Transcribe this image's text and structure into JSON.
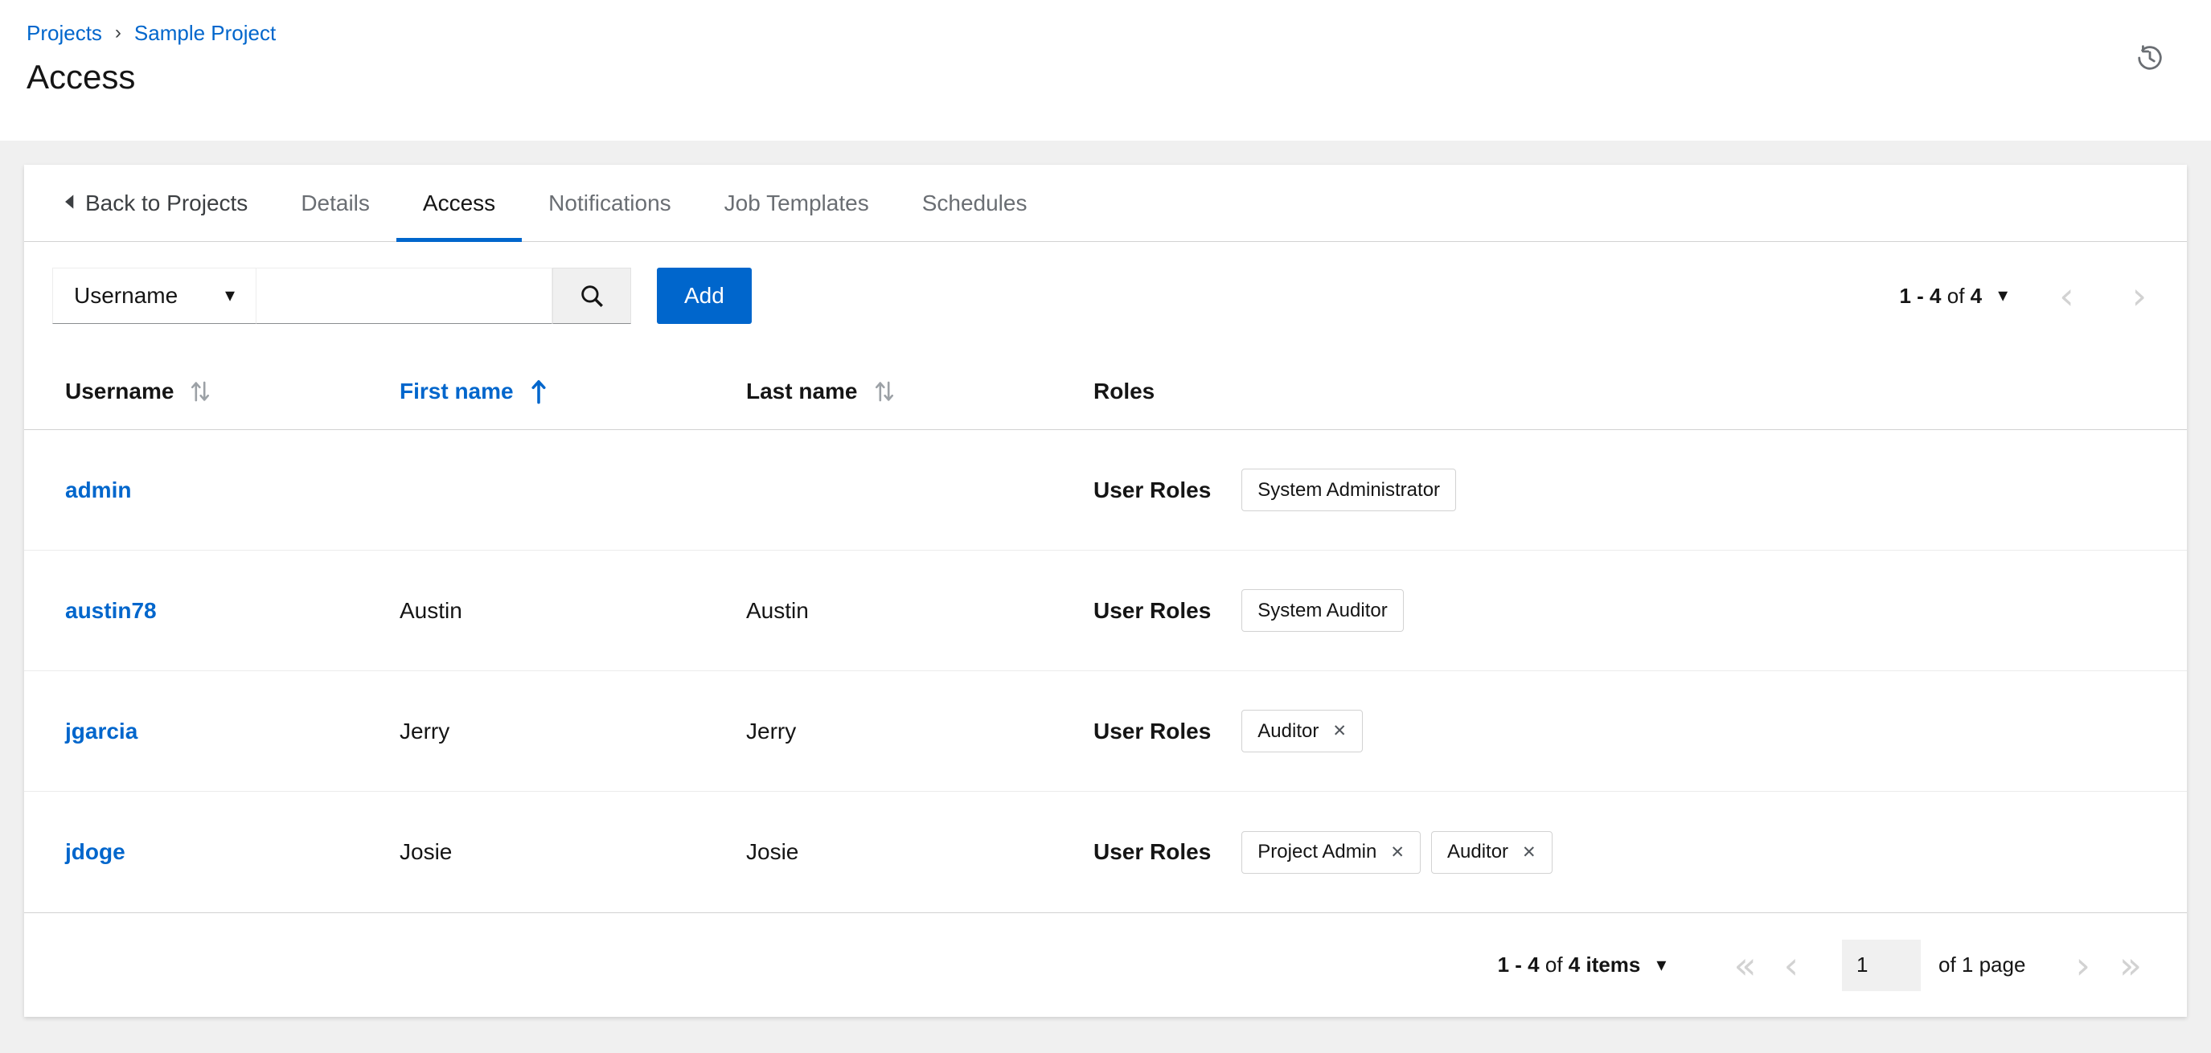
{
  "breadcrumb": {
    "separator": "›",
    "items": [
      {
        "label": "Projects"
      },
      {
        "label": "Sample Project"
      }
    ]
  },
  "page": {
    "title": "Access"
  },
  "tabs": {
    "back_label": "Back to Projects",
    "active": "Access",
    "items": [
      {
        "label": "Details"
      },
      {
        "label": "Access"
      },
      {
        "label": "Notifications"
      },
      {
        "label": "Job Templates"
      },
      {
        "label": "Schedules"
      }
    ]
  },
  "toolbar": {
    "filter_dropdown": {
      "selected": "Username"
    },
    "search": {
      "value": ""
    },
    "add_button": {
      "label": "Add"
    },
    "pagination": {
      "range": "1 - 4",
      "of": "of",
      "total": "4"
    }
  },
  "table": {
    "columns": [
      {
        "label": "Username",
        "sortable": true,
        "sorted": ""
      },
      {
        "label": "First name",
        "sortable": true,
        "sorted": "asc"
      },
      {
        "label": "Last name",
        "sortable": true,
        "sorted": ""
      },
      {
        "label": "Roles",
        "sortable": false,
        "sorted": ""
      }
    ],
    "roles_label": "User Roles",
    "rows": [
      {
        "username": "admin",
        "first_name": "",
        "last_name": "",
        "roles": [
          {
            "label": "System Administrator",
            "removable": false
          }
        ]
      },
      {
        "username": "austin78",
        "first_name": "Austin",
        "last_name": "Austin",
        "roles": [
          {
            "label": "System Auditor",
            "removable": false
          }
        ]
      },
      {
        "username": "jgarcia",
        "first_name": "Jerry",
        "last_name": "Jerry",
        "roles": [
          {
            "label": "Auditor",
            "removable": true
          }
        ]
      },
      {
        "username": "jdoge",
        "first_name": "Josie",
        "last_name": "Josie",
        "roles": [
          {
            "label": "Project Admin",
            "removable": true
          },
          {
            "label": "Auditor",
            "removable": true
          }
        ]
      }
    ]
  },
  "footer": {
    "pagination": {
      "range": "1 - 4",
      "of": "of",
      "total": "4 items"
    },
    "nav": {
      "page_value": "1",
      "page_label": "of 1 page"
    }
  },
  "colors": {
    "link_blue": "#0066cc",
    "primary_button": "#0066cc",
    "text_dark": "#151515",
    "text_gray": "#6a6e73",
    "border_gray": "#d2d2d2",
    "background_gray": "#f0f0f0"
  }
}
